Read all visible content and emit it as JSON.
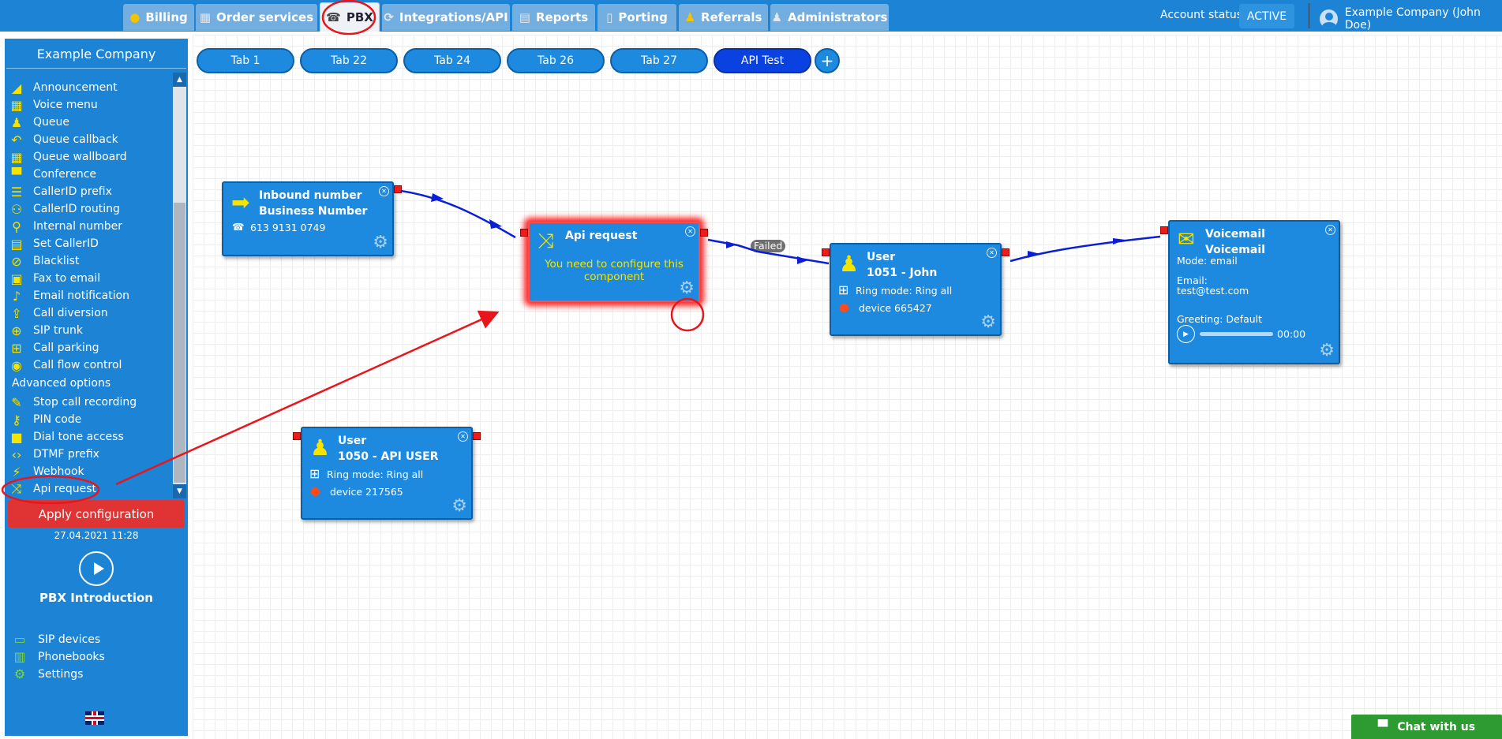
{
  "topnav": {
    "tabs": [
      {
        "label": "Billing",
        "icon": "coins-icon"
      },
      {
        "label": "Order services",
        "icon": "cart-icon"
      },
      {
        "label": "PBX",
        "icon": "pbx-icon"
      },
      {
        "label": "Integrations/API",
        "icon": "integration-icon"
      },
      {
        "label": "Reports",
        "icon": "report-icon"
      },
      {
        "label": "Porting",
        "icon": "phone-icon"
      },
      {
        "label": "Referrals",
        "icon": "referral-icon"
      },
      {
        "label": "Administrators",
        "icon": "admin-icon"
      }
    ],
    "active_tab": "PBX",
    "account_status_label": "Account status:",
    "account_status_value": "ACTIVE",
    "user_name": "Example Company (John Doe)"
  },
  "sidebar": {
    "company": "Example Company",
    "components": [
      {
        "label": "Announcement",
        "icon": "megaphone-icon"
      },
      {
        "label": "Voice menu",
        "icon": "grid-icon"
      },
      {
        "label": "Queue",
        "icon": "user-plus-icon"
      },
      {
        "label": "Queue callback",
        "icon": "reply-icon"
      },
      {
        "label": "Queue wallboard",
        "icon": "table-icon"
      },
      {
        "label": "Conference",
        "icon": "chat-icon"
      },
      {
        "label": "CallerID prefix",
        "icon": "list-icon"
      },
      {
        "label": "CallerID routing",
        "icon": "sitemap-icon"
      },
      {
        "label": "Internal number",
        "icon": "pin-icon"
      },
      {
        "label": "Set CallerID",
        "icon": "id-card-icon"
      },
      {
        "label": "Blacklist",
        "icon": "ban-icon"
      },
      {
        "label": "Fax to email",
        "icon": "fax-icon"
      },
      {
        "label": "Email notification",
        "icon": "bell-icon"
      },
      {
        "label": "Call diversion",
        "icon": "upload-icon"
      },
      {
        "label": "SIP trunk",
        "icon": "globe-icon"
      },
      {
        "label": "Call parking",
        "icon": "cart-icon"
      },
      {
        "label": "Call flow control",
        "icon": "toggle-icon"
      }
    ],
    "advanced_heading": "Advanced options",
    "advanced": [
      {
        "label": "Stop call recording",
        "icon": "mic-off-icon"
      },
      {
        "label": "PIN code",
        "icon": "key-icon"
      },
      {
        "label": "Dial tone access",
        "icon": "lock-icon"
      },
      {
        "label": "DTMF prefix",
        "icon": "code-icon"
      },
      {
        "label": "Webhook",
        "icon": "webhook-icon"
      },
      {
        "label": "Api request",
        "icon": "shuffle-icon"
      }
    ],
    "apply_label": "Apply configuration",
    "apply_date": "27.04.2021 11:28",
    "intro_label": "PBX Introduction",
    "links": [
      {
        "label": "SIP devices",
        "icon": "monitor-icon"
      },
      {
        "label": "Phonebooks",
        "icon": "book-icon"
      },
      {
        "label": "Settings",
        "icon": "gear-icon"
      }
    ],
    "language_flag": "uk-flag-icon"
  },
  "canvas": {
    "tabs": [
      "Tab 1",
      "Tab 22",
      "Tab 24",
      "Tab 26",
      "Tab 27",
      "API Test"
    ],
    "active_tab": "API Test",
    "add_tab_icon": "plus-icon",
    "nodes": {
      "inbound": {
        "title": "Inbound number",
        "subtitle": "Business Number",
        "number": "613 9131 0749"
      },
      "api": {
        "title": "Api request",
        "warning": "You need to configure this component"
      },
      "user_john": {
        "title": "User",
        "subtitle": "1051 - John",
        "ring_mode": "Ring mode: Ring all",
        "device": "device 665427"
      },
      "voicemail": {
        "title": "Voicemail",
        "subtitle": "Voicemail",
        "mode": "Mode: email",
        "email_label": "Email:",
        "email_value": "test@test.com",
        "greeting": "Greeting: Default",
        "time": "00:00"
      },
      "user_api": {
        "title": "User",
        "subtitle": "1050 - API USER",
        "ring_mode": "Ring mode: Ring all",
        "device": "device 217565"
      }
    },
    "edge_label": "Failed"
  },
  "chat": {
    "label": "Chat with us"
  },
  "colors": {
    "topbar": "#1d83d4",
    "accent_yellow": "#f4e400",
    "apply_red": "#e03434",
    "highlight_red": "#e8151b",
    "connector_blue": "#0a1fd6",
    "chat_green": "#2e9a32"
  }
}
